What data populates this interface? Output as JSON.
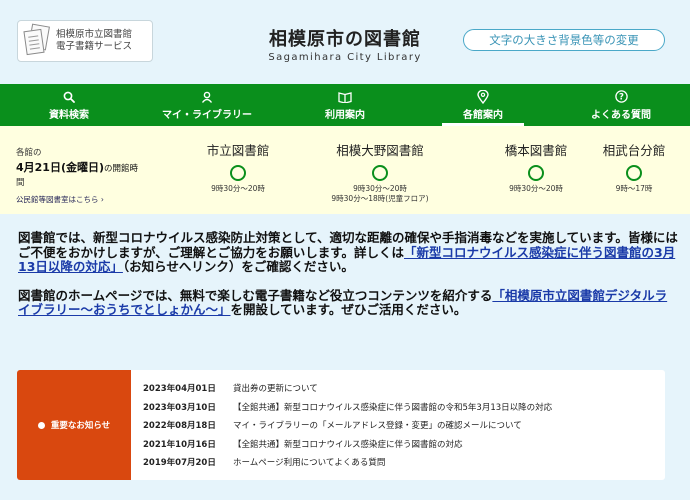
{
  "header": {
    "ebook_line1": "相模原市立図書館",
    "ebook_line2": "電子書籍サービス",
    "title_jp": "相模原市の図書館",
    "title_en": "Sagamihara City Library",
    "access_label": "文字の大きさ背景色等の変更"
  },
  "nav": [
    {
      "label": "資料検索",
      "icon": "search-icon"
    },
    {
      "label": "マイ・ライブラリー",
      "icon": "user-icon"
    },
    {
      "label": "利用案内",
      "icon": "book-icon"
    },
    {
      "label": "各館案内",
      "icon": "map-pin-icon"
    },
    {
      "label": "よくある質問",
      "icon": "question-icon"
    }
  ],
  "hours": {
    "pre": "各館の",
    "date": "4月21日(金曜日)",
    "suffix": "の開館時",
    "after": "間",
    "calendar_link": "公民館等図書室はこちら ›",
    "branches": [
      {
        "name": "市立図書館",
        "time1": "9時30分～20時",
        "time2": ""
      },
      {
        "name": "相模大野図書館",
        "time1": "9時30分～20時",
        "time2": "9時30分～18時(児童フロア)"
      },
      {
        "name": "橋本図書館",
        "time1": "9時30分～20時",
        "time2": ""
      },
      {
        "name": "相武台分館",
        "time1": "9時～17時",
        "time2": ""
      }
    ]
  },
  "notice": {
    "p1_text": "図書館では、新型コロナウイルス感染防止対策として、適切な距離の確保や手指消毒などを実施しています。皆様にはご不便をおかけしますが、ご理解とご協力をお願いします。詳しくは",
    "p1_link": "「新型コロナウイルス感染症に伴う図書館の3月13日以降の対応」",
    "p1_after": "（お知らせへリンク）をご確認ください。",
    "p2_text": "図書館のホームページでは、無料で楽しむ電子書籍など役立つコンテンツを紹介する",
    "p2_link": "「相模原市立図書館デジタルライブラリー～おうちでとしょかん～」",
    "p2_after": "を開設しています。ぜひご活用ください。"
  },
  "news": {
    "tag": "重要なお知らせ",
    "items": [
      {
        "date": "2023年04月01日",
        "title": "貸出券の更新について"
      },
      {
        "date": "2023年03月10日",
        "title": "【全館共通】新型コロナウイルス感染症に伴う図書館の令和5年3月13日以降の対応"
      },
      {
        "date": "2022年08月18日",
        "title": "マイ・ライブラリーの「メールアドレス登録・変更」の確認メールについて"
      },
      {
        "date": "2021年10月16日",
        "title": "【全館共通】新型コロナウイルス感染症に伴う図書館の対応"
      },
      {
        "date": "2019年07月20日",
        "title": "ホームページ利用についてよくある質問"
      }
    ]
  },
  "colors": {
    "nav_green": "#0a8f1c",
    "accent_blue": "#3a94b6",
    "news_orange": "#d9480f",
    "hours_bg": "#ffffe0",
    "page_bg": "#e6f4fb"
  }
}
